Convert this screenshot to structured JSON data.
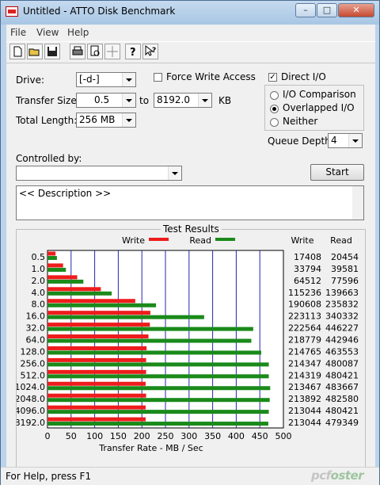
{
  "window": {
    "title": "Untitled - ATTO Disk Benchmark",
    "minimize": "–",
    "maximize": "□",
    "close": "✕"
  },
  "menu": [
    "File",
    "View",
    "Help"
  ],
  "toolbar": {
    "icons": [
      "new-icon",
      "open-icon",
      "save-icon",
      "print-icon",
      "print-preview-icon",
      "move-icon",
      "help-icon",
      "context-help-icon"
    ]
  },
  "form": {
    "drive_label": "Drive:",
    "drive_value": "[-d-]",
    "transfer_size_label": "Transfer Size:",
    "transfer_from": "0.5",
    "to_label": "to",
    "transfer_to": "8192.0",
    "kb_label": "KB",
    "total_length_label": "Total Length:",
    "total_length_value": "256 MB",
    "force_write_label": "Force Write Access",
    "force_write_checked": false,
    "direct_io_label": "Direct I/O",
    "direct_io_checked": true,
    "io_comparison_label": "I/O Comparison",
    "overlapped_io_label": "Overlapped I/O",
    "neither_label": "Neither",
    "io_mode_selected": "Overlapped I/O",
    "queue_depth_label": "Queue Depth:",
    "queue_depth_value": "4",
    "controlled_by_label": "Controlled by:",
    "controlled_by_value": "",
    "start_label": "Start",
    "description": "<< Description >>"
  },
  "results": {
    "title": "Test Results",
    "write_legend": "Write",
    "read_legend": "Read",
    "write_header": "Write",
    "read_header": "Read",
    "write_color": "#ee1c1c",
    "read_color": "#1a8a1a"
  },
  "chart_data": {
    "type": "bar",
    "orientation": "horizontal",
    "title": "Test Results",
    "xlabel": "Transfer Rate - MB / Sec",
    "xlim": [
      0,
      500
    ],
    "xticks": [
      0,
      50,
      100,
      150,
      200,
      250,
      300,
      350,
      400,
      450,
      500
    ],
    "grid": true,
    "legend": "top",
    "categories": [
      "0.5",
      "1.0",
      "2.0",
      "4.0",
      "8.0",
      "16.0",
      "32.0",
      "64.0",
      "128.0",
      "256.0",
      "512.0",
      "1024.0",
      "2048.0",
      "4096.0",
      "8192.0"
    ],
    "series": [
      {
        "name": "Write",
        "color": "#ee1c1c",
        "values": [
          17,
          33,
          63,
          113,
          186,
          218,
          217,
          214,
          210,
          209,
          209,
          208,
          209,
          208,
          208
        ],
        "labels": [
          "17408",
          "33794",
          "64512",
          "115236",
          "190608",
          "223113",
          "222564",
          "218779",
          "214765",
          "214347",
          "214319",
          "213467",
          "213892",
          "213044",
          "213044"
        ]
      },
      {
        "name": "Read",
        "color": "#1a8a1a",
        "values": [
          20,
          39,
          76,
          136,
          230,
          332,
          436,
          432,
          453,
          469,
          469,
          472,
          471,
          469,
          468
        ],
        "labels": [
          "20454",
          "39581",
          "77596",
          "139663",
          "235832",
          "340332",
          "446227",
          "442946",
          "463553",
          "480087",
          "480421",
          "483667",
          "482580",
          "480421",
          "479349"
        ]
      }
    ]
  },
  "status": {
    "text": "For Help, press F1",
    "watermark_a": "pcf",
    "watermark_b": "oster"
  }
}
